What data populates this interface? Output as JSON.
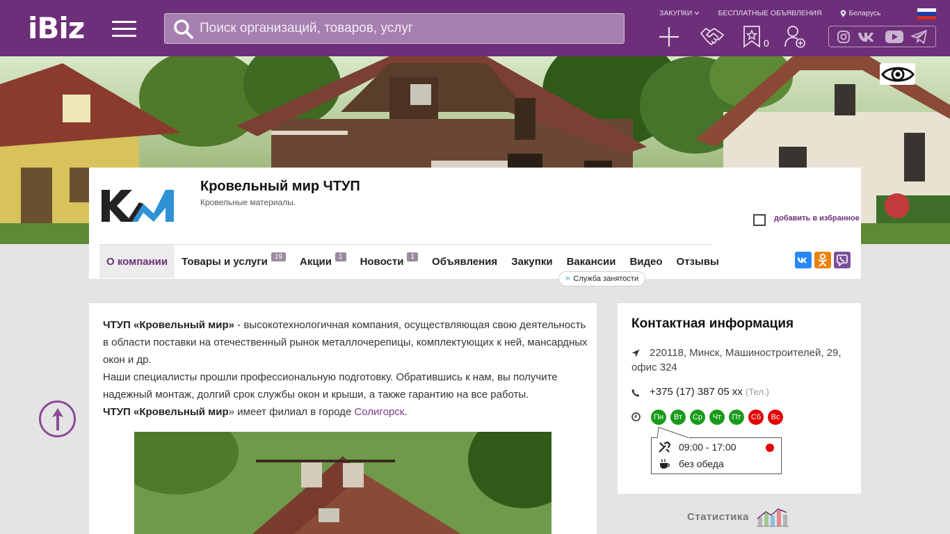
{
  "header": {
    "logo": "iBiz",
    "search_placeholder": "Поиск организаций, товаров, услуг",
    "links": {
      "procurements": "ЗАКУПКИ",
      "free_ads": "БЕСПЛАТНЫЕ ОБЪЯВЛЕНИЯ",
      "region": "Беларусь"
    },
    "favorites_count": "0",
    "colors": {
      "brand": "#6d2f79"
    }
  },
  "company": {
    "name": "Кровельный мир ЧТУП",
    "description": "Кровельные материалы.",
    "add_favorite": "добавить в избранное",
    "logo_text": "КМ"
  },
  "tabs": [
    {
      "label": "О компании",
      "count": ""
    },
    {
      "label": "Товары и услуги",
      "count": "19"
    },
    {
      "label": "Акции",
      "count": "1"
    },
    {
      "label": "Новости",
      "count": "1"
    },
    {
      "label": "Объявления",
      "count": ""
    },
    {
      "label": "Закупки",
      "count": ""
    },
    {
      "label": "Вакансии",
      "count": ""
    },
    {
      "label": "Видео",
      "count": ""
    },
    {
      "label": "Отзывы",
      "count": ""
    }
  ],
  "employment_badge": "Служба занятости",
  "about": {
    "p1_bold": "ЧТУП «",
    "p1_bold2": "Кровельный мир",
    "p1_bold3": "»",
    "p1_rest": " - высокотехнологичная компания, осуществляющая свою деятельность в области поставки на отечественный рынок металлочерепицы, комплектующих к ней, мансардных окон и др.",
    "p2": "Наши специалисты прошли профессиональную подготовку. Обратившись к нам, вы получите надежный монтаж, долгий срок службы окон и крыши, а также гарантию на все работы.",
    "p3_start": "ЧТУП «",
    "p3_bold": "Кровельный мир",
    "p3_mid": "» имеет филиал в городе ",
    "p3_link": "Солигорск",
    "p3_end": "."
  },
  "contacts": {
    "title": "Контактная информация",
    "address": "220118, Минск, Машиностроителей, 29, офис 324",
    "phone": "+375 (17) 387 05 xx",
    "phone_type": "(Тел.)",
    "days": [
      {
        "label": "Пн",
        "color": "#1a9a1a"
      },
      {
        "label": "Вт",
        "color": "#1a9a1a"
      },
      {
        "label": "Ср",
        "color": "#1a9a1a"
      },
      {
        "label": "Чт",
        "color": "#1a9a1a"
      },
      {
        "label": "Пт",
        "color": "#1a9a1a"
      },
      {
        "label": "Сб",
        "color": "#e00000"
      },
      {
        "label": "Вс",
        "color": "#e00000"
      }
    ],
    "hours": "09:00 - 17:00",
    "lunch": "без обеда"
  },
  "stats_label": "Статистика"
}
